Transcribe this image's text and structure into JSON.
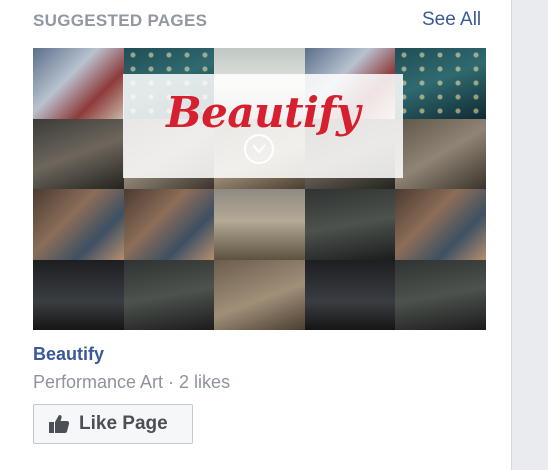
{
  "header": {
    "title": "SUGGESTED PAGES",
    "see_all": "See All"
  },
  "page": {
    "cover_text": "Beautify",
    "name": "Beautify",
    "meta": "Performance Art · 2 likes",
    "like_button": "Like Page"
  },
  "colors": {
    "link": "#3b5998",
    "muted": "#9197a3",
    "brand_red": "#d6202f"
  },
  "icons": [
    "chevron-down-icon",
    "thumbs-up-icon"
  ]
}
